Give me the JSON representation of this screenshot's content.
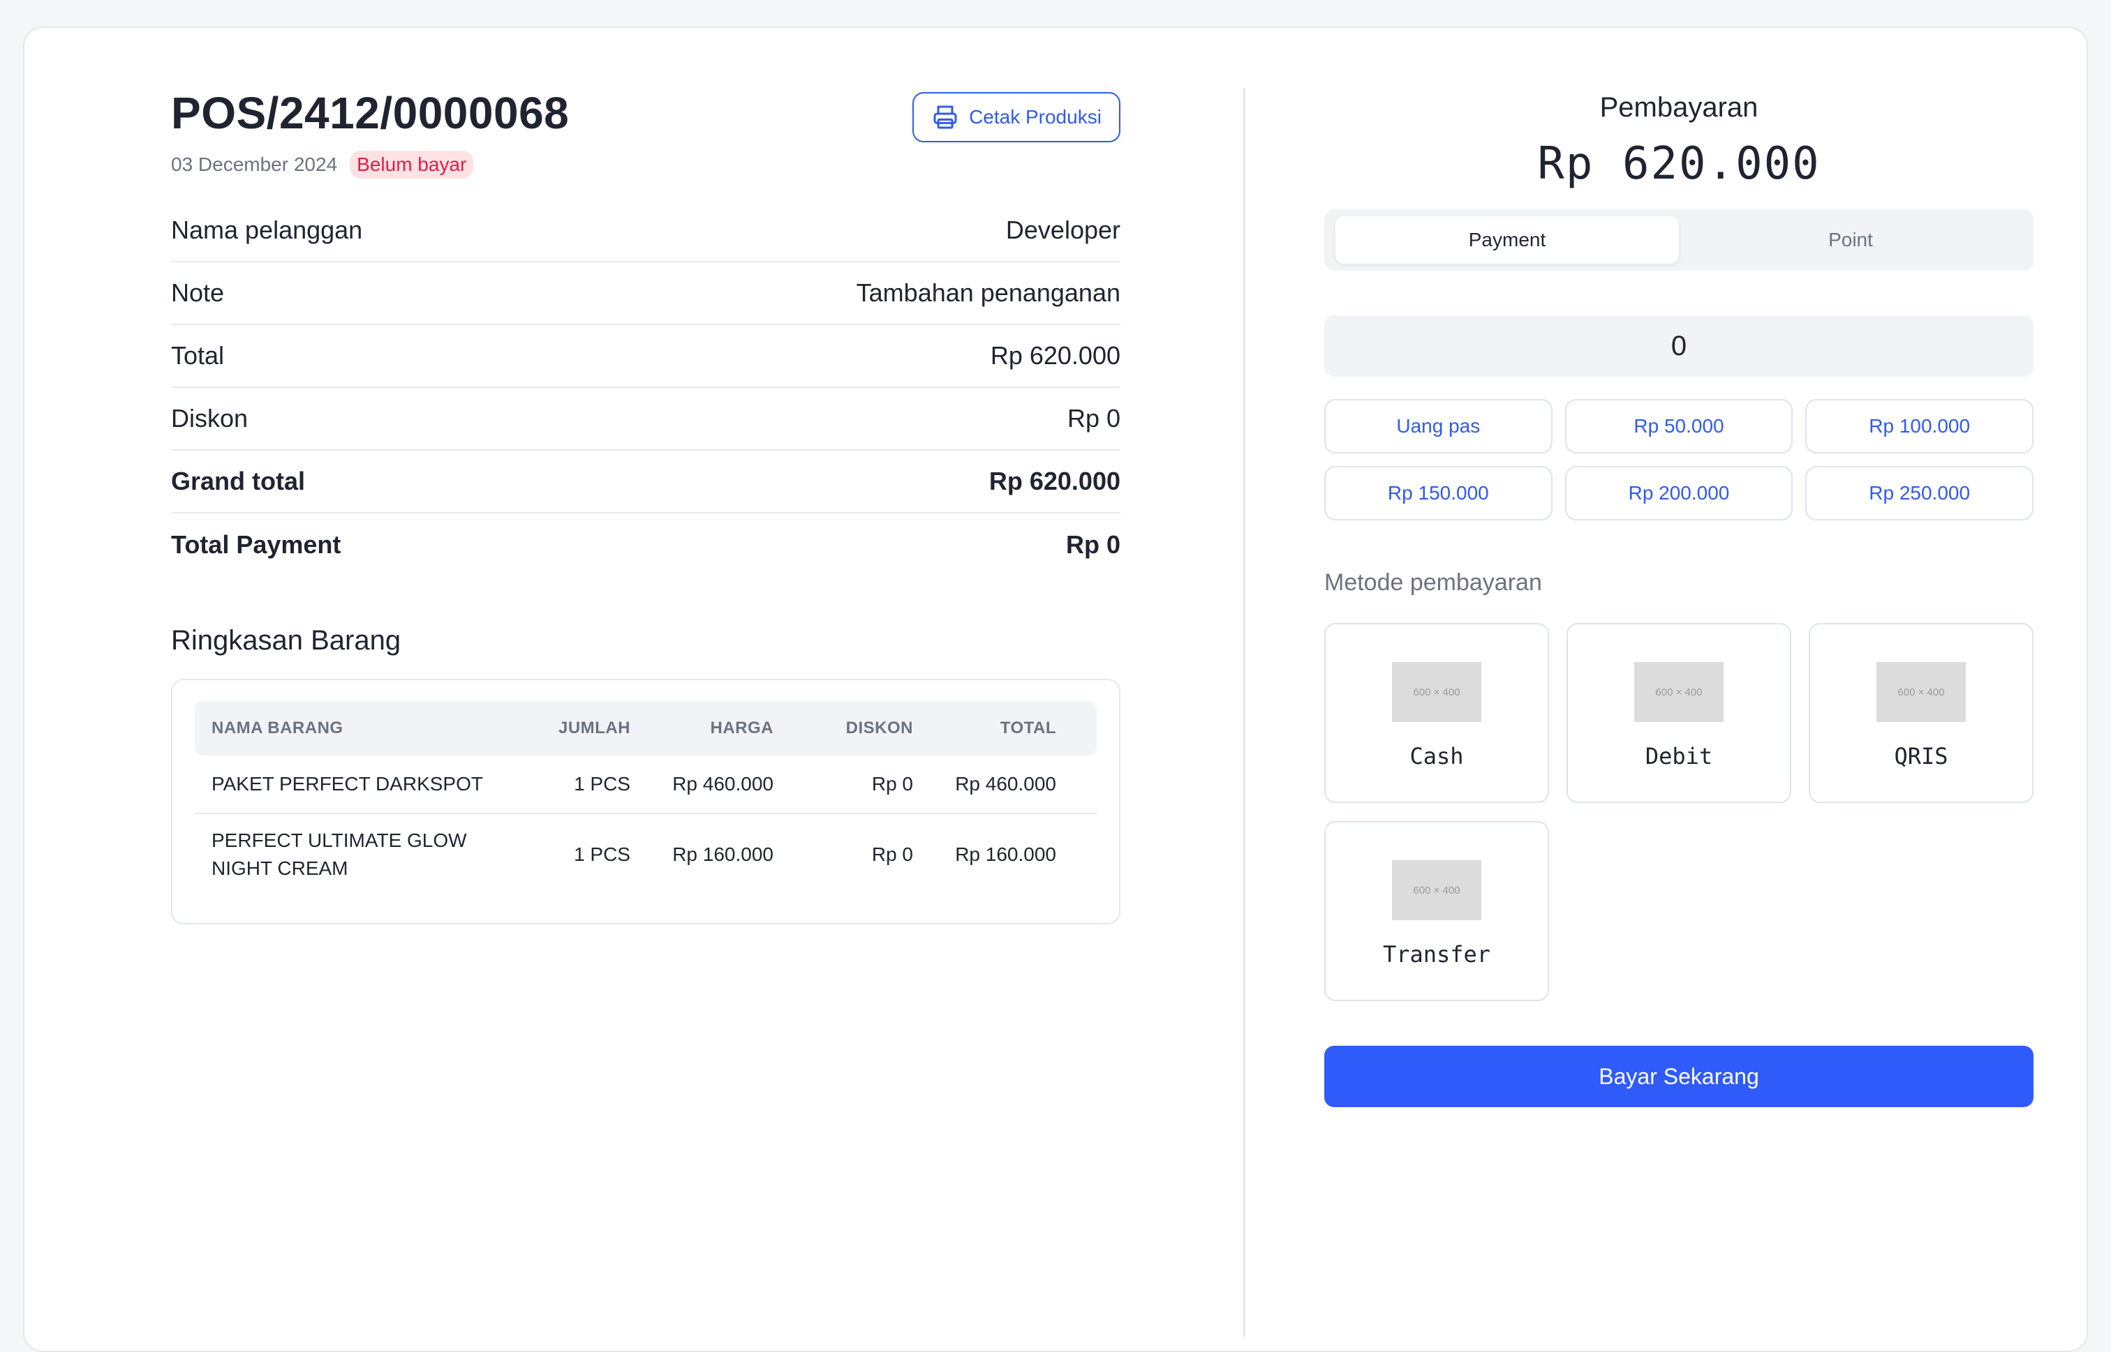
{
  "order": {
    "id": "POS/2412/0000068",
    "date": "03 December 2024",
    "status": "Belum bayar",
    "print_label": "Cetak Produksi"
  },
  "info": [
    {
      "label": "Nama pelanggan",
      "value": "Developer"
    },
    {
      "label": "Note",
      "value": "Tambahan penanganan"
    },
    {
      "label": "Total",
      "value": "Rp 620.000"
    },
    {
      "label": "Diskon",
      "value": "Rp 0"
    },
    {
      "label": "Grand total",
      "value": "Rp 620.000"
    },
    {
      "label": "Total Payment",
      "value": "Rp 0"
    }
  ],
  "summary": {
    "title": "Ringkasan Barang",
    "columns": [
      "NAMA BARANG",
      "JUMLAH",
      "HARGA",
      "DISKON",
      "TOTAL"
    ],
    "rows": [
      {
        "name": "PAKET PERFECT DARKSPOT",
        "qty": "1 PCS",
        "price": "Rp 460.000",
        "discount": "Rp 0",
        "total": "Rp 460.000"
      },
      {
        "name": "PERFECT ULTIMATE GLOW NIGHT CREAM",
        "qty": "1 PCS",
        "price": "Rp 160.000",
        "discount": "Rp 0",
        "total": "Rp 160.000"
      }
    ]
  },
  "payment": {
    "title": "Pembayaran",
    "amount": "Rp 620.000",
    "tabs": [
      {
        "label": "Payment",
        "active": true
      },
      {
        "label": "Point",
        "active": false
      }
    ],
    "input_value": "0",
    "quick_amounts": [
      "Uang pas",
      "Rp 50.000",
      "Rp 100.000",
      "Rp 150.000",
      "Rp 200.000",
      "Rp 250.000"
    ],
    "method_title": "Metode pembayaran",
    "placeholder_image_text": "600 × 400",
    "methods": [
      "Cash",
      "Debit",
      "QRIS",
      "Transfer"
    ],
    "submit_label": "Bayar Sekarang"
  },
  "colors": {
    "accent": "#2f5bea",
    "primary_button": "#2f5bfa",
    "status_badge_bg": "#fde2e4",
    "status_badge_text": "#e11d48"
  },
  "icons": {
    "print": "printer-icon"
  }
}
